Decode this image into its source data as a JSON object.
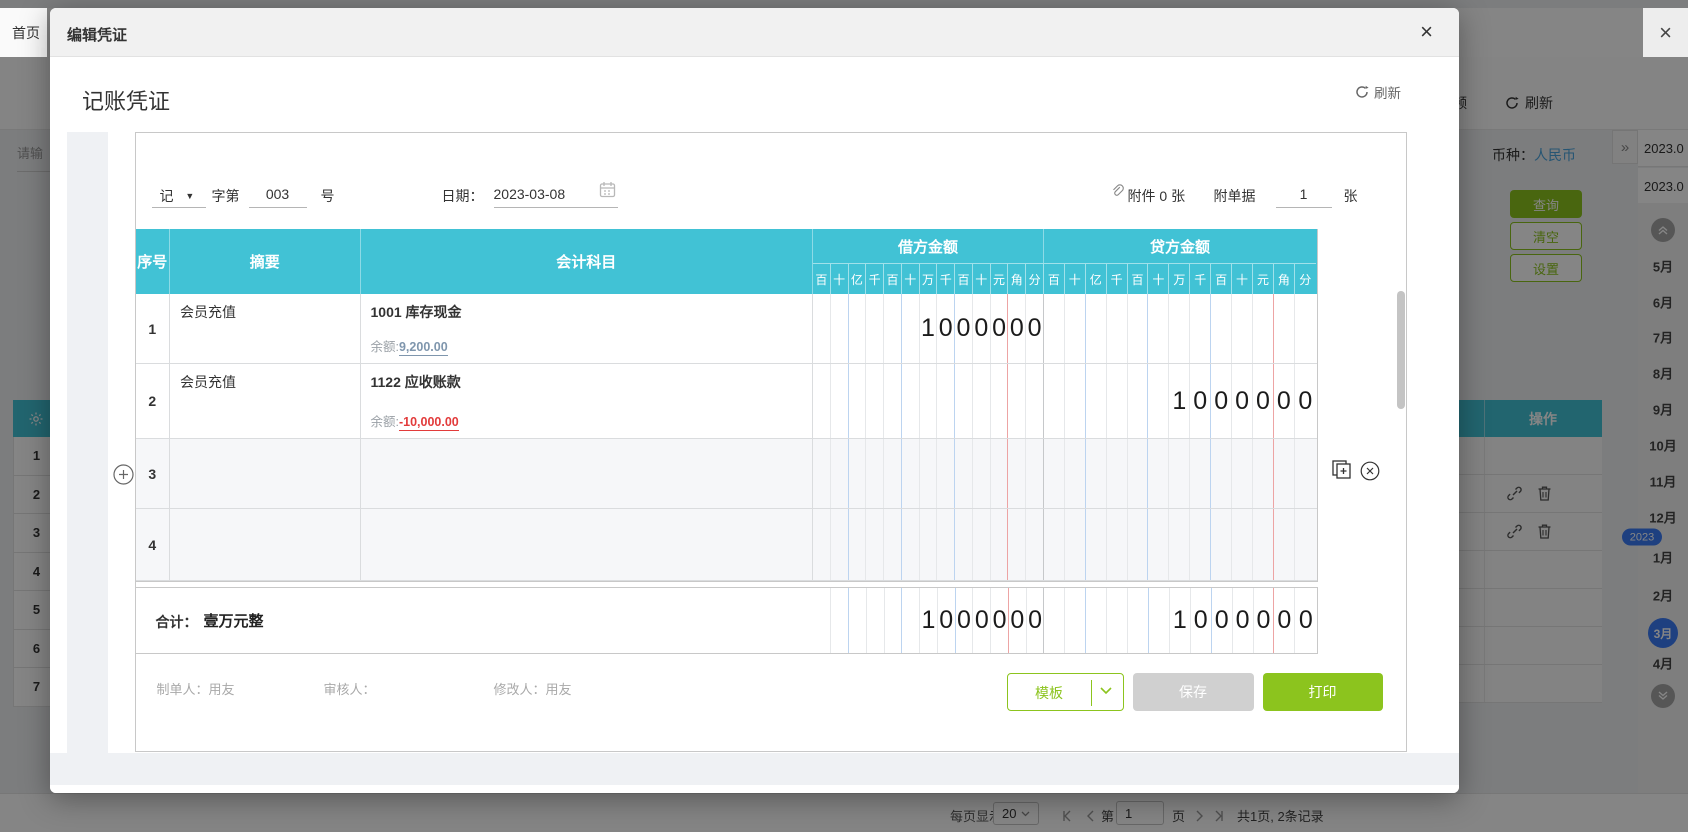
{
  "background": {
    "home_tab": "首页",
    "partial_tab": "频",
    "refresh_label": "刷新",
    "search_placeholder": "请输",
    "currency_label": "币种：",
    "currency_value": "人民币",
    "buttons": {
      "query": "查询",
      "clear": "清空",
      "settings": "设置"
    },
    "table": {
      "operation_header": "操作",
      "row_numbers": [
        "1",
        "2",
        "3",
        "4",
        "5",
        "6",
        "7"
      ],
      "op_rows": [
        {
          "icons": false
        },
        {
          "icons": true
        },
        {
          "icons": true
        },
        {
          "icons": false
        },
        {
          "icons": false
        },
        {
          "icons": false
        },
        {
          "icons": false
        }
      ]
    },
    "date_items": [
      "2023.0",
      "2023.0"
    ],
    "collapse_glyph": "»",
    "sidebar_items": [
      {
        "label": "5月",
        "type": "month"
      },
      {
        "label": "6月",
        "type": "month"
      },
      {
        "label": "7月",
        "type": "month"
      },
      {
        "label": "8月",
        "type": "month"
      },
      {
        "label": "9月",
        "type": "month"
      },
      {
        "label": "10月",
        "type": "month"
      },
      {
        "label": "11月",
        "type": "month"
      },
      {
        "label": "12月",
        "type": "month"
      },
      {
        "label": "2023",
        "type": "badge"
      },
      {
        "label": "1月",
        "type": "month"
      },
      {
        "label": "2月",
        "type": "month"
      },
      {
        "label": "3月",
        "type": "active"
      },
      {
        "label": "4月",
        "type": "month"
      }
    ],
    "pagination": {
      "per_page_label": "每页显示",
      "per_page": "20",
      "page_prefix": "第",
      "page_value": "1",
      "page_suffix": "页",
      "summary": "共1页, 2条记录"
    }
  },
  "modal": {
    "title": "编辑凭证",
    "close_glyph": "×",
    "refresh_label": "刷新",
    "voucher_title": "记账凭证",
    "form": {
      "type_value": "记",
      "zidi_label": "字第",
      "number_value": "003",
      "hao_label": "号",
      "date_label": "日期：",
      "date_value": "2023-03-08",
      "attach_label": "附件 0 张",
      "fudanju_label": "附单据",
      "fudanju_value": "1",
      "zhang_label": "张"
    },
    "table": {
      "headers": {
        "no": "序号",
        "summary": "摘要",
        "account": "会计科目",
        "debit": "借方金额",
        "credit": "贷方金额"
      },
      "digit_labels": [
        "百",
        "十",
        "亿",
        "千",
        "百",
        "十",
        "万",
        "千",
        "百",
        "十",
        "元",
        "角",
        "分"
      ],
      "rows": [
        {
          "no": "1",
          "summary": "会员充值",
          "account": "1001 库存现金",
          "balance_label": "余额:",
          "balance": "9,200.00",
          "balance_negative": false,
          "debit": "1000000",
          "credit": ""
        },
        {
          "no": "2",
          "summary": "会员充值",
          "account": "1122 应收账款",
          "balance_label": "余额:",
          "balance": "-10,000.00",
          "balance_negative": true,
          "debit": "",
          "credit": "1000000"
        },
        {
          "no": "3",
          "summary": "",
          "account": "",
          "balance_label": "",
          "balance": "",
          "balance_negative": false,
          "debit": "",
          "credit": ""
        },
        {
          "no": "4",
          "summary": "",
          "account": "",
          "balance_label": "",
          "balance": "",
          "balance_negative": false,
          "debit": "",
          "credit": ""
        }
      ],
      "total_label": "合计：",
      "total_cn": "壹万元整",
      "total_debit": "1000000",
      "total_credit": "1000000"
    },
    "footer": {
      "maker": "制单人：用友",
      "auditor": "审核人：",
      "modifier": "修改人：用友",
      "template_btn": "模板",
      "save_btn": "保存",
      "print_btn": "打印"
    }
  },
  "colors": {
    "teal_header": "#41c2d5",
    "green_accent": "#8cc41e",
    "blue_badge": "#3b7bf5",
    "red_negative": "#e23b3b",
    "link_blue": "#4aa3dd"
  }
}
